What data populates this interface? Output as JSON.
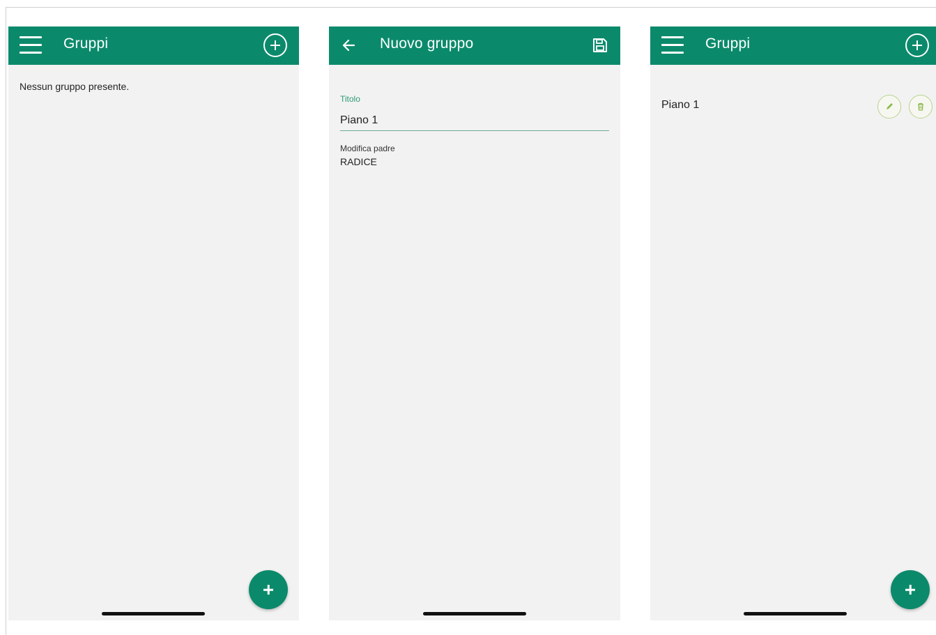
{
  "screens": [
    {
      "id": "gruppi-empty",
      "title": "Gruppi",
      "empty_message": "Nessun gruppo presente."
    },
    {
      "id": "nuovo-gruppo",
      "title": "Nuovo gruppo",
      "fields": {
        "title_label": "Titolo",
        "title_value": "Piano 1",
        "parent_label": "Modifica padre",
        "parent_value": "RADICE"
      }
    },
    {
      "id": "gruppi-list",
      "title": "Gruppi",
      "items": [
        {
          "label": "Piano 1"
        }
      ]
    }
  ],
  "icons": {
    "menu": "hamburger-menu-icon",
    "add": "plus-circle-icon",
    "back": "arrow-left-icon",
    "save": "floppy-disk-icon",
    "edit": "pencil-icon",
    "delete": "trash-icon",
    "fab": "plus-icon"
  },
  "colors": {
    "primary": "#0b8a6b",
    "background": "#f2f2f2",
    "field_label": "#2e9a78",
    "action_outline": "#b7d48c",
    "action_icon": "#8dbb4d"
  }
}
